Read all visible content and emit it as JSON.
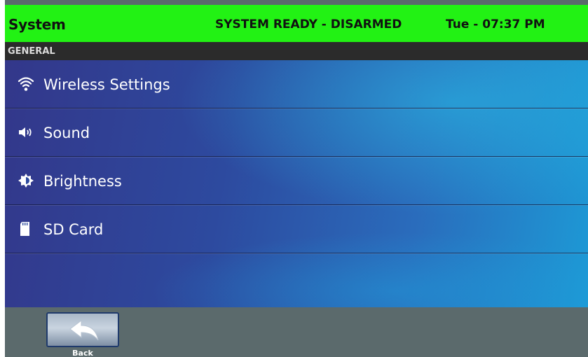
{
  "status_bar": {
    "title": "System",
    "state": "SYSTEM READY - DISARMED",
    "clock": "Tue - 07:37 PM",
    "color": "#22f214"
  },
  "section": {
    "header": "GENERAL"
  },
  "menu": {
    "items": [
      {
        "label": "Wireless Settings",
        "icon": "wifi-icon"
      },
      {
        "label": "Sound",
        "icon": "speaker-icon"
      },
      {
        "label": "Brightness",
        "icon": "brightness-icon"
      },
      {
        "label": "SD Card",
        "icon": "sd-card-icon"
      }
    ]
  },
  "footer": {
    "back_label": "Back",
    "back_icon": "back-arrow-icon"
  }
}
